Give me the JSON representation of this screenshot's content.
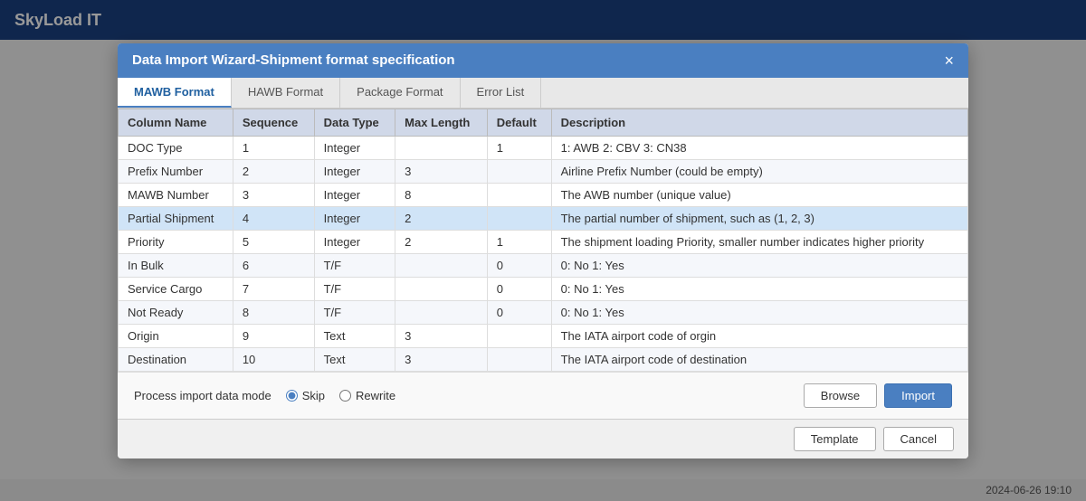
{
  "app": {
    "logo": "SkyLoad IT",
    "timestamp": "2024-06-26 19:10"
  },
  "modal": {
    "title": "Data Import Wizard-Shipment format specification",
    "close_label": "×"
  },
  "tabs": [
    {
      "id": "mawb",
      "label": "MAWB Format",
      "active": true
    },
    {
      "id": "hawb",
      "label": "HAWB Format",
      "active": false
    },
    {
      "id": "package",
      "label": "Package Format",
      "active": false
    },
    {
      "id": "error",
      "label": "Error List",
      "active": false
    }
  ],
  "table": {
    "headers": [
      "Column Name",
      "Sequence",
      "Data Type",
      "Max Length",
      "Default",
      "Description"
    ],
    "rows": [
      {
        "name": "DOC Type",
        "sequence": "1",
        "data_type": "Integer",
        "max_length": "",
        "default": "1",
        "description": "1: AWB    2: CBV    3: CN38",
        "highlight": false
      },
      {
        "name": "Prefix Number",
        "sequence": "2",
        "data_type": "Integer",
        "max_length": "3",
        "default": "",
        "description": "Airline Prefix Number (could be empty)",
        "highlight": false
      },
      {
        "name": "MAWB Number",
        "sequence": "3",
        "data_type": "Integer",
        "max_length": "8",
        "default": "",
        "description": "The AWB number (unique value)",
        "highlight": false
      },
      {
        "name": "Partial Shipment",
        "sequence": "4",
        "data_type": "Integer",
        "max_length": "2",
        "default": "",
        "description": "The partial number of shipment, such as (1, 2, 3)",
        "highlight": true
      },
      {
        "name": "Priority",
        "sequence": "5",
        "data_type": "Integer",
        "max_length": "2",
        "default": "1",
        "description": "The shipment loading Priority, smaller number indicates higher priority",
        "highlight": false
      },
      {
        "name": "In Bulk",
        "sequence": "6",
        "data_type": "T/F",
        "max_length": "",
        "default": "0",
        "description": "0: No    1: Yes",
        "highlight": false
      },
      {
        "name": "Service Cargo",
        "sequence": "7",
        "data_type": "T/F",
        "max_length": "",
        "default": "0",
        "description": "0: No    1: Yes",
        "highlight": false
      },
      {
        "name": "Not Ready",
        "sequence": "8",
        "data_type": "T/F",
        "max_length": "",
        "default": "0",
        "description": "0: No    1: Yes",
        "highlight": false
      },
      {
        "name": "Origin",
        "sequence": "9",
        "data_type": "Text",
        "max_length": "3",
        "default": "",
        "description": "The IATA airport code of orgin",
        "highlight": false
      },
      {
        "name": "Destination",
        "sequence": "10",
        "data_type": "Text",
        "max_length": "3",
        "default": "",
        "description": "The IATA airport code of destination",
        "highlight": false
      }
    ]
  },
  "import_mode": {
    "label": "Process import data mode",
    "options": [
      {
        "id": "skip",
        "label": "Skip",
        "checked": true
      },
      {
        "id": "rewrite",
        "label": "Rewrite",
        "checked": false
      }
    ],
    "browse_label": "Browse",
    "import_label": "Import"
  },
  "footer": {
    "template_label": "Template",
    "cancel_label": "Cancel"
  }
}
